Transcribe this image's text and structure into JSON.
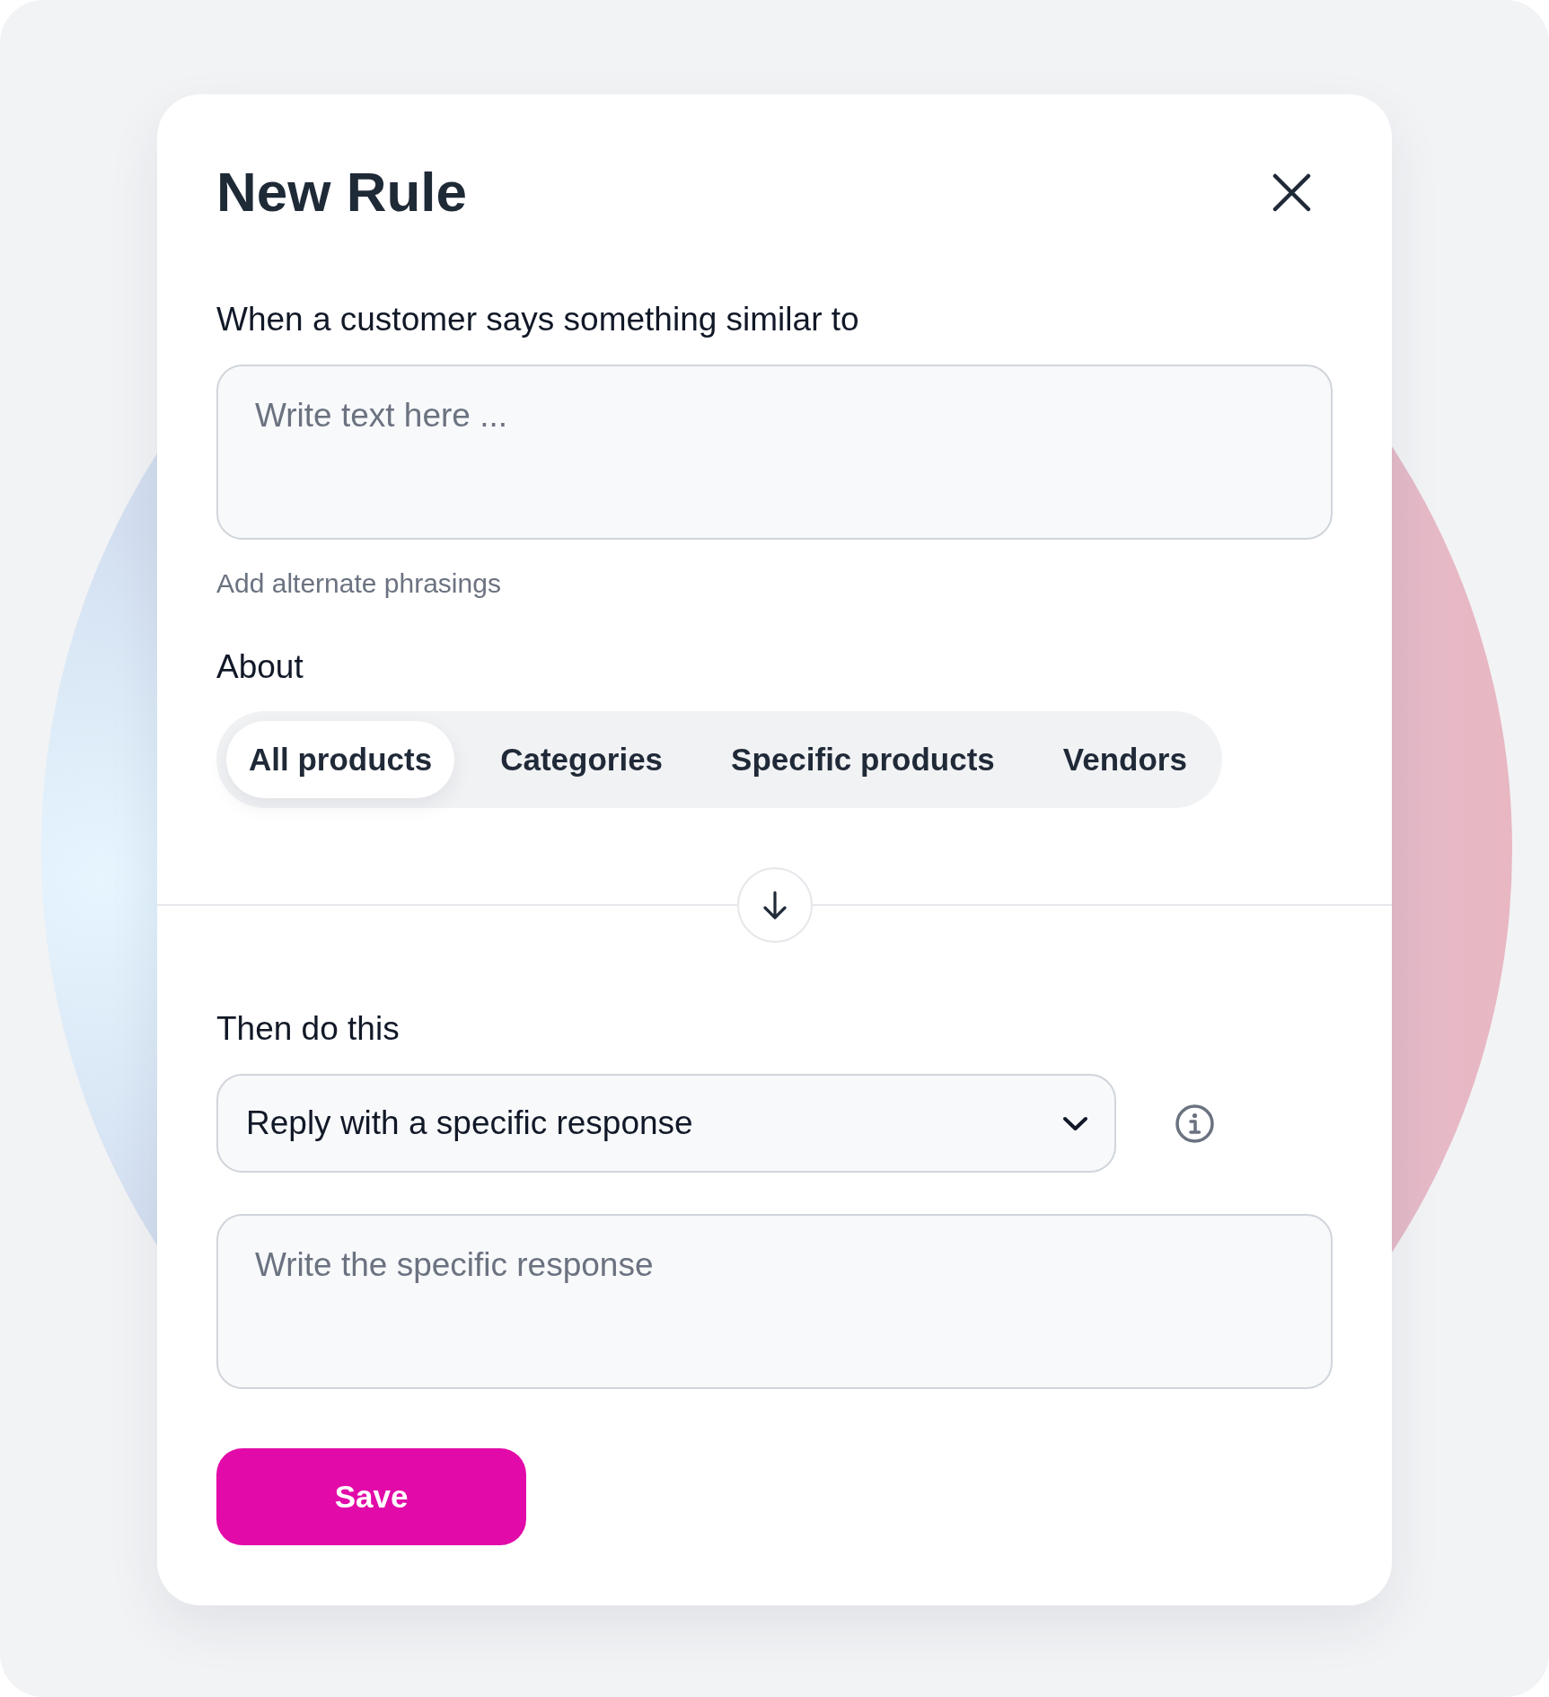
{
  "dialog": {
    "title": "New Rule"
  },
  "trigger": {
    "label": "When a customer says something similar to",
    "input": {
      "placeholder": "Write text here ..."
    },
    "link": "Add alternate phrasings"
  },
  "about": {
    "label": "About",
    "tabs": [
      {
        "label": "All products",
        "selected": true
      },
      {
        "label": "Categories",
        "selected": false
      },
      {
        "label": "Specific products",
        "selected": false
      },
      {
        "label": "Vendors",
        "selected": false
      }
    ]
  },
  "action": {
    "label": "Then do this",
    "select": {
      "value": "Reply with a specific response"
    },
    "response": {
      "placeholder": "Write the specific response"
    }
  },
  "save_button": {
    "label": "Save"
  }
}
